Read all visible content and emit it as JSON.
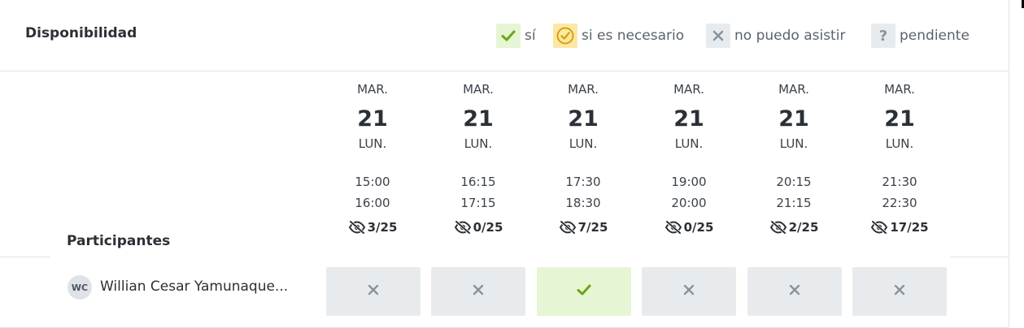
{
  "title": "Disponibilidad",
  "legend": [
    {
      "key": "yes",
      "icon": "check-icon",
      "label": "sí"
    },
    {
      "key": "ifneeded",
      "icon": "circle-check-icon",
      "label": "si es necesario"
    },
    {
      "key": "no",
      "icon": "x-icon",
      "label": "no puedo asistir"
    },
    {
      "key": "pending",
      "icon": "question-icon",
      "label": "pendiente"
    }
  ],
  "colors": {
    "yes": "#6aa617",
    "ifneeded": "#d7a300",
    "no": "#8a939c",
    "pending": "#8a939c"
  },
  "participants_label": "Participantes",
  "slots": [
    {
      "month": "MAR.",
      "day": "21",
      "weekday": "LUN.",
      "start": "15:00",
      "end": "16:00",
      "count": "3/25"
    },
    {
      "month": "MAR.",
      "day": "21",
      "weekday": "LUN.",
      "start": "16:15",
      "end": "17:15",
      "count": "0/25"
    },
    {
      "month": "MAR.",
      "day": "21",
      "weekday": "LUN.",
      "start": "17:30",
      "end": "18:30",
      "count": "7/25"
    },
    {
      "month": "MAR.",
      "day": "21",
      "weekday": "LUN.",
      "start": "19:00",
      "end": "20:00",
      "count": "0/25"
    },
    {
      "month": "MAR.",
      "day": "21",
      "weekday": "LUN.",
      "start": "20:15",
      "end": "21:15",
      "count": "2/25"
    },
    {
      "month": "MAR.",
      "day": "21",
      "weekday": "LUN.",
      "start": "21:30",
      "end": "22:30",
      "count": "17/25"
    }
  ],
  "participant": {
    "initials": "WC",
    "name": "Willian Cesar Yamunaque...",
    "responses": [
      "no",
      "no",
      "yes",
      "no",
      "no",
      "no"
    ]
  }
}
